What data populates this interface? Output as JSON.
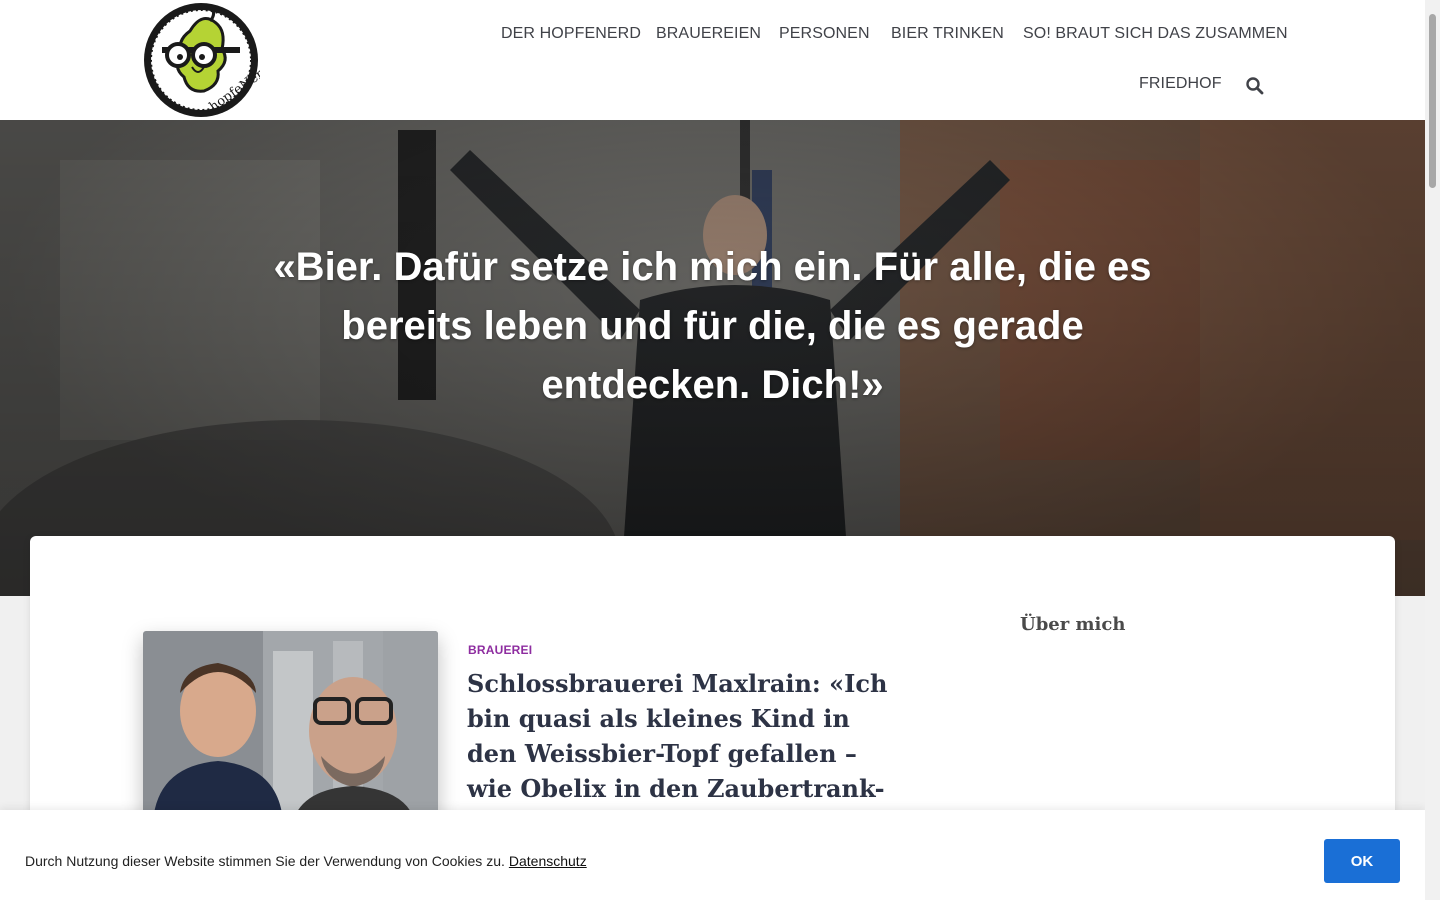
{
  "header": {
    "logo_text": "hopfeNerd",
    "nav": [
      {
        "label": "DER HOPFENERD"
      },
      {
        "label": "BRAUEREIEN"
      },
      {
        "label": "PERSONEN"
      },
      {
        "label": "BIER TRINKEN"
      },
      {
        "label": "SO! BRAUT SICH DAS ZUSAMMEN"
      },
      {
        "label": "FRIEDHOF"
      }
    ],
    "search_icon": "search-icon"
  },
  "hero": {
    "quote": "«Bier. Dafür setze ich mich ein. Für alle, die es bereits leben und für die, die es gerade entdecken. Dich!»"
  },
  "post": {
    "category": "BRAUEREI",
    "title": "Schlossbrauerei Maxlrain: «Ich bin quasi als kleines Kind in den Weissbier-Topf gefallen – wie Obelix in den Zaubertrank-Kessel.»"
  },
  "sidebar": {
    "widget_title": "Über mich"
  },
  "cookie": {
    "text": "Durch Nutzung dieser Website stimmen Sie der Verwendung von Cookies zu.",
    "link": "Datenschutz",
    "ok": "OK"
  },
  "colors": {
    "category": "#8e2da0",
    "button": "#1a6fd6",
    "logo_green": "#b5d334"
  }
}
